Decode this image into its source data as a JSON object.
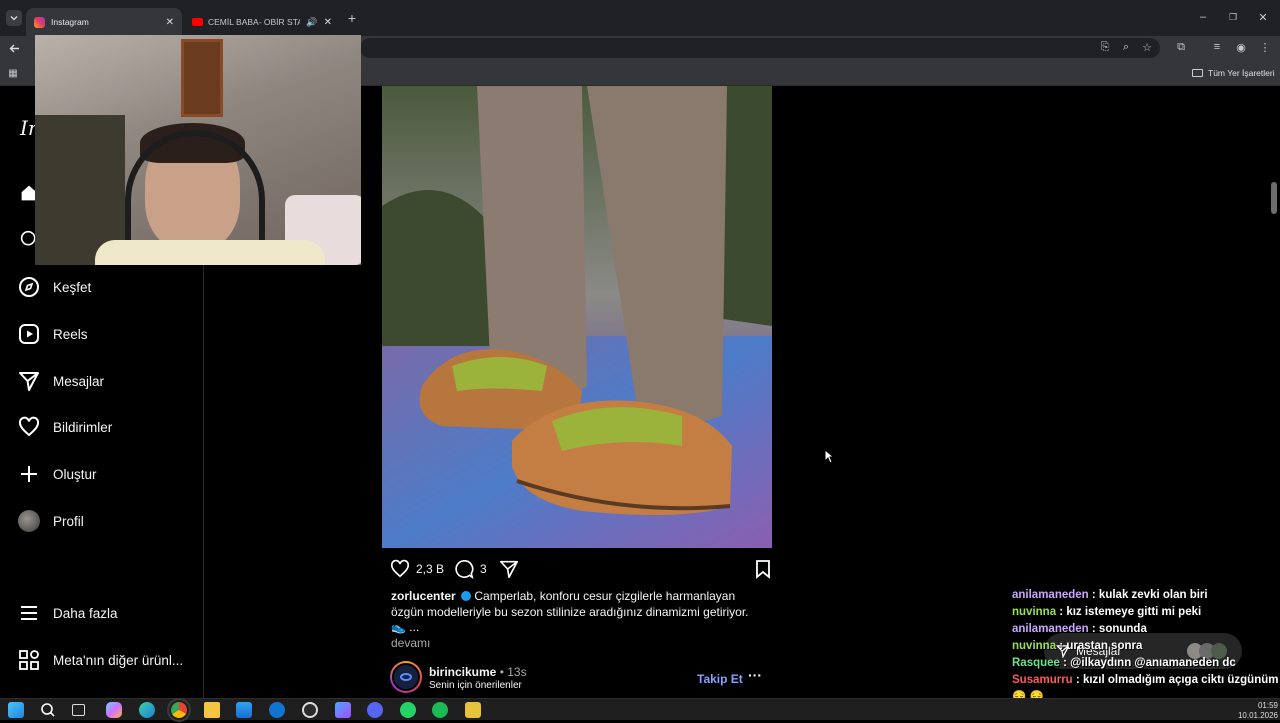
{
  "browser": {
    "tabs": [
      {
        "title": "Instagram",
        "active": true
      },
      {
        "title": "CEMİL BABA- OBİR STAR - C",
        "active": false
      }
    ],
    "bookmarks_all": "Tüm Yer İşaretleri"
  },
  "sidebar": {
    "logo_partial": "In",
    "items": [
      {
        "label": "Keşfet",
        "icon": "compass-icon"
      },
      {
        "label": "Reels",
        "icon": "reels-icon"
      },
      {
        "label": "Mesajlar",
        "icon": "send-icon"
      },
      {
        "label": "Bildirimler",
        "icon": "heart-icon"
      },
      {
        "label": "Oluştur",
        "icon": "plus-icon"
      },
      {
        "label": "Profil",
        "icon": "avatar"
      }
    ],
    "more": "Daha fazla",
    "meta_products": "Meta'nın diğer ürünl..."
  },
  "post": {
    "likes": "2,3 B",
    "comments": "3",
    "caption_user": "zorlucenter",
    "caption_text": " Camperlab, konforu cesur çizgilerle harmanlayan özgün modelleriyle bu sezon stilinize aradığınız dinamizmi getiriyor. 👟 ...",
    "more_link": "devamı"
  },
  "suggested": {
    "username": "birincikume",
    "time": "• 13s",
    "subtitle": "Senin için önerilenler",
    "follow": "Takip Et"
  },
  "messages_float": "Mesajlar",
  "chat": [
    {
      "user": "anilamaneden",
      "color": "#c9a7ff",
      "text": ": kulak zevki olan biri"
    },
    {
      "user": "nuvinna",
      "color": "#9be05a",
      "text": ": kız istemeye gitti mi peki"
    },
    {
      "user": "anilamaneden",
      "color": "#c9a7ff",
      "text": ": sonunda"
    },
    {
      "user": "nuvinna",
      "color": "#9be05a",
      "text": ": urastan sonra"
    },
    {
      "user": "Rasquee",
      "color": "#6fe08a",
      "text": ": @ilkaydınn @anıamaneden dc"
    },
    {
      "user": "Susamurru",
      "color": "#ff5a5a",
      "text": ": kızıl olmadığım açıga ciktı üzgünüm 😔 😔"
    }
  ],
  "taskbar": {
    "time": "01:59",
    "date": "10.01.2026"
  }
}
